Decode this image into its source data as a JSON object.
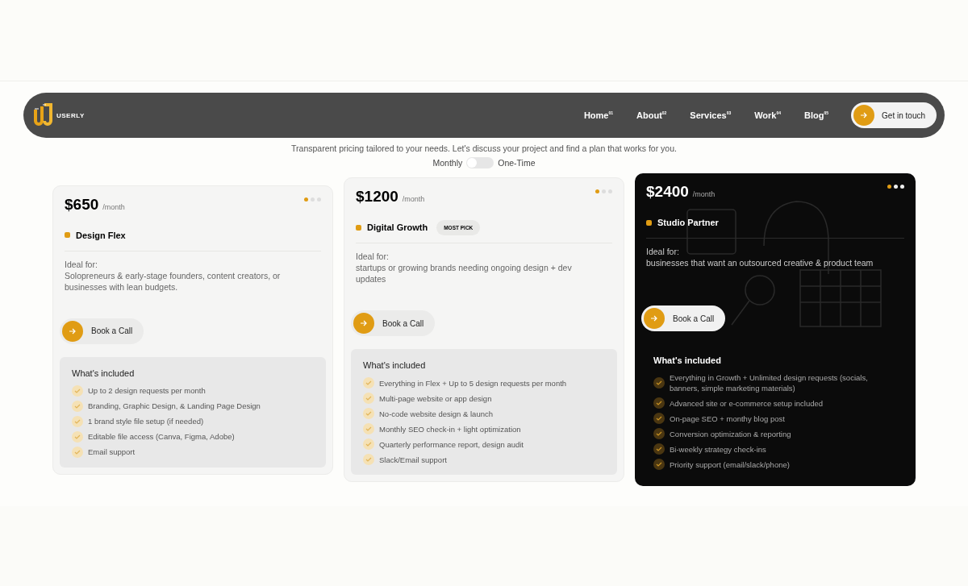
{
  "nav": {
    "logo_text": "USERLY",
    "links": [
      {
        "label": "Home",
        "number": "01"
      },
      {
        "label": "About",
        "number": "02"
      },
      {
        "label": "Services",
        "number": "03"
      },
      {
        "label": "Work",
        "number": "04"
      },
      {
        "label": "Blog",
        "number": "05"
      }
    ],
    "cta": "Get in touch"
  },
  "intro": {
    "text": "Transparent pricing tailored to your needs. Let's discuss your project and find a plan that works for you."
  },
  "billing_toggle": {
    "left": "Monthly",
    "right": "One-Time",
    "on": false
  },
  "plans": [
    {
      "dark": false,
      "price": "$650",
      "period": "/month",
      "name": "Design Flex",
      "dots": [
        {
          "selected": true
        },
        {
          "selected": false
        },
        {
          "selected": false
        }
      ],
      "ideal_label": "Ideal for:",
      "ideal_text": "Solopreneurs & early-stage founders, content creators, or businesses with lean budgets.",
      "button": "Book a Call",
      "included_title": "What's included",
      "features": [
        "Up to 2 design requests per month",
        "Branding, Graphic Design, & Landing Page Design",
        "1 brand style file setup (if needed)",
        "Editable file access (Canva, Figma, Adobe)",
        "Email support"
      ]
    },
    {
      "dark": false,
      "price": "$1200",
      "period": "/month",
      "name": "Digital Growth",
      "badge": "MOST PICK",
      "dots": [
        {
          "selected": true
        },
        {
          "selected": false
        },
        {
          "selected": false
        }
      ],
      "ideal_label": "Ideal for:",
      "ideal_text": "startups or growing brands needing ongoing design + dev updates",
      "button": "Book a Call",
      "included_title": "What's included",
      "features": [
        "Everything in Flex + Up to 5 design requests per month",
        "Multi-page website or app design",
        "No-code website design & launch",
        "Monthly SEO check-in + light optimization",
        "Quarterly performance report, design audit",
        "Slack/Email support"
      ]
    },
    {
      "dark": true,
      "price": "$2400",
      "period": "/month",
      "name": "Studio Partner",
      "dots": [
        {
          "selected": true
        },
        {
          "selected": false
        },
        {
          "selected": false
        }
      ],
      "ideal_label": "Ideal for:",
      "ideal_text": "businesses that want an outsourced creative & product team",
      "button": "Book a Call",
      "included_title": "What's included",
      "features": [
        "Everything in Growth + Unlimited design requests (socials, banners, simple marketing materials)",
        "Advanced site or e-commerce setup included",
        "On-page SEO + monthy blog post",
        "Conversion optimization & reporting",
        "Bi-weekly strategy check-ins",
        "Priority support (email/slack/phone)"
      ]
    }
  ]
}
